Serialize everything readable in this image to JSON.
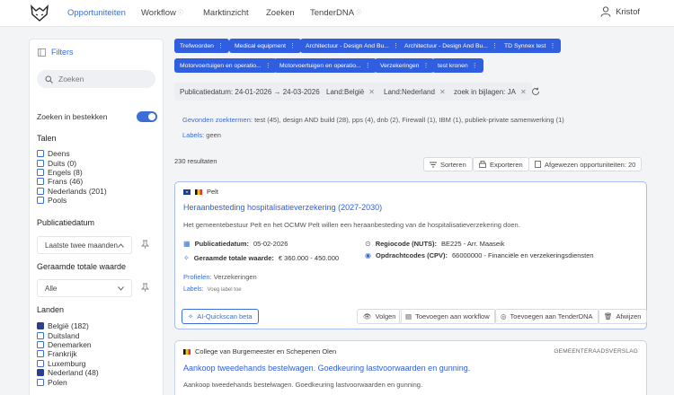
{
  "nav": {
    "items": [
      {
        "label": "Opportuniteiten",
        "active": true,
        "info": false
      },
      {
        "label": "Workflow",
        "active": false,
        "info": true
      },
      {
        "label": "Marktinzicht",
        "active": false,
        "info": false
      },
      {
        "label": "Zoeken",
        "active": false,
        "info": false
      },
      {
        "label": "TenderDNA",
        "active": false,
        "info": true
      }
    ],
    "info_glyph": "ⓘ",
    "user_name": "Kristof"
  },
  "sidebar": {
    "title": "Filters",
    "search_placeholder": "Zoeken",
    "search_in_attachments_label": "Zoeken in bestekken",
    "search_in_attachments_on": true,
    "languages": {
      "title": "Talen",
      "items": [
        {
          "label": "Deens",
          "checked": false
        },
        {
          "label": "Duits (0)",
          "checked": false
        },
        {
          "label": "Engels (8)",
          "checked": false
        },
        {
          "label": "Frans (46)",
          "checked": false
        },
        {
          "label": "Nederlands (201)",
          "checked": false
        },
        {
          "label": "Pools",
          "checked": false
        }
      ]
    },
    "publication_date": {
      "title": "Publicatiedatum",
      "selected": "Laatste twee maanden"
    },
    "estimated_value": {
      "title": "Geraamde totale waarde",
      "selected": "Alle"
    },
    "countries": {
      "title": "Landen",
      "items": [
        {
          "label": "België (182)",
          "checked": true
        },
        {
          "label": "Duitsland",
          "checked": false
        },
        {
          "label": "Denemarken",
          "checked": false
        },
        {
          "label": "Frankrijk",
          "checked": false
        },
        {
          "label": "Luxemburg",
          "checked": false
        },
        {
          "label": "Nederland (48)",
          "checked": true
        },
        {
          "label": "Polen",
          "checked": false
        }
      ]
    }
  },
  "profile_chips": [
    "Trefwoorden",
    "Medical equipment",
    "Architectuur - Design And Bu...",
    "Architectuur - Design And Bu...",
    "TD Synnex test",
    "Motorvoertuigen en operatio...",
    "Motorvoertuigen en operatio...",
    "Verzekeringen",
    "test kronen"
  ],
  "active_filters": [
    {
      "label": "Publicatiedatum: 24-01-2026 → 24-03-2026",
      "removable": false
    },
    {
      "label": "Land:België",
      "removable": true
    },
    {
      "label": "Land:Nederland",
      "removable": true
    },
    {
      "label": "zoek in bijlagen: JA",
      "removable": true
    }
  ],
  "found_terms": {
    "label": "Gevonden zoektermen:",
    "value": "test (45), design AND build (28), pps (4), dnb (2), Firewall (1), IBM (1), publiek-private samenwerking (1)"
  },
  "labels_line": {
    "label": "Labels:",
    "value": "geen"
  },
  "results_count": "230 resultaten",
  "toolbar": {
    "sort": "Sorteren",
    "export": "Exporteren",
    "rejected": "Afgewezen opportuniteiten: 20"
  },
  "cards": [
    {
      "org": "Pelt",
      "title": "Heraanbesteding hospitalisatieverzekering (2027-2030)",
      "description": "Het gemeentebestuur Pelt en het OCMW Pelt willen een heraanbesteding van de hospitalisatieverzekering doen.",
      "pub_date_label": "Publicatiedatum:",
      "pub_date": "05-02-2026",
      "value_label": "Geraamde totale waarde:",
      "value": "€ 360.000 - 450.000",
      "region_label": "Regiocode (NUTS):",
      "region": "BE225 - Arr. Maaseik",
      "cpv_label": "Opdrachtcodes (CPV):",
      "cpv": "66000000 - Financiële en verzekeringsdiensten",
      "profiles_label": "Profielen:",
      "profiles": "Verzekeringen",
      "labels_label": "Labels:",
      "add_label": "Voeg label toe",
      "actions": {
        "ai": "AI-Quickscan beta",
        "follow": "Volgen",
        "workflow": "Toevoegen aan workflow",
        "tenderdna": "Toevoegen aan TenderDNA",
        "reject": "Afwijzen"
      }
    },
    {
      "org": "College van Burgemeester en Schepenen Olen",
      "type": "GEMEENTERAADSVERSLAG",
      "title": "Aankoop tweedehands bestelwagen. Goedkeuring lastvoorwaarden en gunning.",
      "description": "Aankoop tweedehands bestelwagen. Goedkeuring lastvoorwaarden en gunning."
    }
  ],
  "colors": {
    "accent": "#3b6ed8",
    "chip": "#2f5fe0",
    "checked": "#2a3f8f"
  }
}
